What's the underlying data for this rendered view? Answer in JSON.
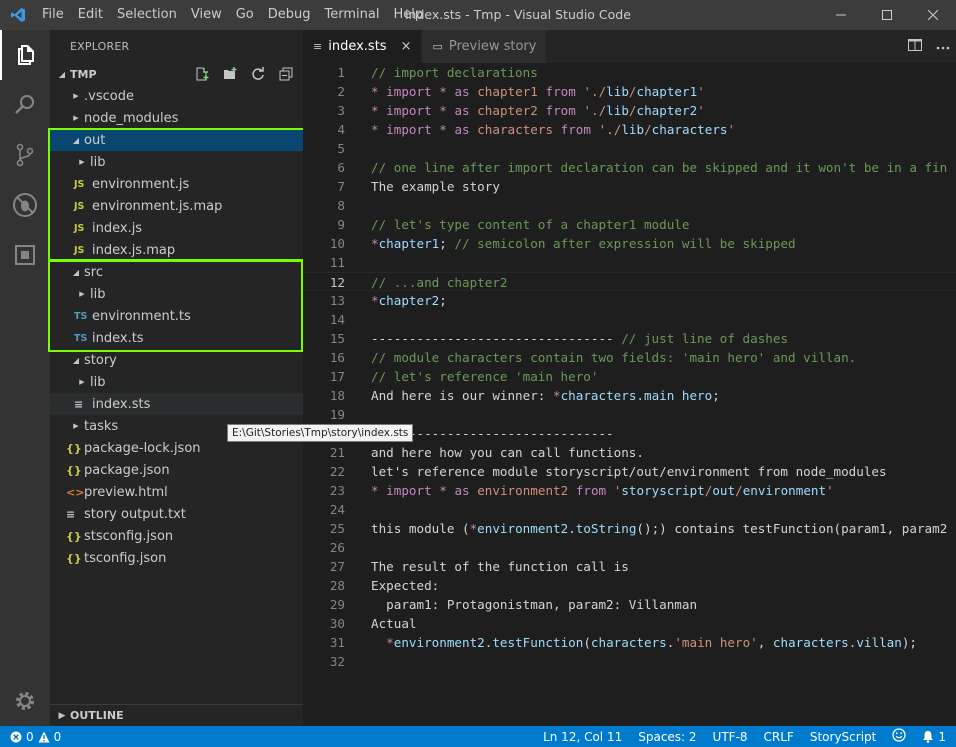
{
  "window": {
    "title": "index.sts - Tmp - Visual Studio Code",
    "menu": [
      "File",
      "Edit",
      "Selection",
      "View",
      "Go",
      "Debug",
      "Terminal",
      "Help"
    ]
  },
  "sidebar": {
    "title": "EXPLORER",
    "root": "TMP",
    "outline": "OUTLINE",
    "tree": [
      {
        "label": ".vscode",
        "indent": 1,
        "type": "folder",
        "open": false
      },
      {
        "label": "node_modules",
        "indent": 1,
        "type": "folder",
        "open": false
      },
      {
        "label": "out",
        "indent": 1,
        "type": "folder",
        "open": true,
        "selected": true
      },
      {
        "label": "lib",
        "indent": 2,
        "type": "folder",
        "open": false
      },
      {
        "label": "environment.js",
        "indent": 2,
        "type": "js"
      },
      {
        "label": "environment.js.map",
        "indent": 2,
        "type": "js"
      },
      {
        "label": "index.js",
        "indent": 2,
        "type": "js"
      },
      {
        "label": "index.js.map",
        "indent": 2,
        "type": "js"
      },
      {
        "label": "src",
        "indent": 1,
        "type": "folder",
        "open": true
      },
      {
        "label": "lib",
        "indent": 2,
        "type": "folder",
        "open": false
      },
      {
        "label": "environment.ts",
        "indent": 2,
        "type": "ts"
      },
      {
        "label": "index.ts",
        "indent": 2,
        "type": "ts"
      },
      {
        "label": "story",
        "indent": 1,
        "type": "folder",
        "open": true
      },
      {
        "label": "lib",
        "indent": 2,
        "type": "folder",
        "open": false
      },
      {
        "label": "index.sts",
        "indent": 2,
        "type": "lines",
        "hover": true
      },
      {
        "label": "tasks",
        "indent": 1,
        "type": "folder",
        "open": false
      },
      {
        "label": "package-lock.json",
        "indent": 1,
        "type": "json"
      },
      {
        "label": "package.json",
        "indent": 1,
        "type": "json"
      },
      {
        "label": "preview.html",
        "indent": 1,
        "type": "html"
      },
      {
        "label": "story output.txt",
        "indent": 1,
        "type": "lines"
      },
      {
        "label": "stsconfig.json",
        "indent": 1,
        "type": "json"
      },
      {
        "label": "tsconfig.json",
        "indent": 1,
        "type": "json"
      }
    ],
    "icon_glyphs": {
      "js": "JS",
      "ts": "TS",
      "json": "{}",
      "html": "<>",
      "lines": "≡"
    }
  },
  "tooltip": "E:\\Git\\Stories\\Tmp\\story\\index.sts",
  "tabs": [
    {
      "label": "index.sts",
      "active": true,
      "close": "×"
    },
    {
      "label": "Preview story",
      "active": false
    }
  ],
  "editor": {
    "current_line": 12,
    "lines": [
      [
        [
          "cm",
          "// import declarations"
        ]
      ],
      [
        [
          "kw",
          "* "
        ],
        [
          "kw",
          "import"
        ],
        [
          "pl",
          " "
        ],
        [
          "kw",
          "*"
        ],
        [
          "pl",
          " "
        ],
        [
          "kw",
          "as"
        ],
        [
          "pl",
          " "
        ],
        [
          "st",
          "chapter1"
        ],
        [
          "pl",
          " "
        ],
        [
          "kw",
          "from"
        ],
        [
          "pl",
          " "
        ],
        [
          "st",
          "'./"
        ],
        [
          "id",
          "lib"
        ],
        [
          "st",
          "/"
        ],
        [
          "id",
          "chapter1"
        ],
        [
          "st",
          "'"
        ]
      ],
      [
        [
          "kw",
          "* "
        ],
        [
          "kw",
          "import"
        ],
        [
          "pl",
          " "
        ],
        [
          "kw",
          "*"
        ],
        [
          "pl",
          " "
        ],
        [
          "kw",
          "as"
        ],
        [
          "pl",
          " "
        ],
        [
          "st",
          "chapter2"
        ],
        [
          "pl",
          " "
        ],
        [
          "kw",
          "from"
        ],
        [
          "pl",
          " "
        ],
        [
          "st",
          "'./"
        ],
        [
          "id",
          "lib"
        ],
        [
          "st",
          "/"
        ],
        [
          "id",
          "chapter2"
        ],
        [
          "st",
          "'"
        ]
      ],
      [
        [
          "kw",
          "* "
        ],
        [
          "kw",
          "import"
        ],
        [
          "pl",
          " "
        ],
        [
          "kw",
          "*"
        ],
        [
          "pl",
          " "
        ],
        [
          "kw",
          "as"
        ],
        [
          "pl",
          " "
        ],
        [
          "st",
          "characters"
        ],
        [
          "pl",
          " "
        ],
        [
          "kw",
          "from"
        ],
        [
          "pl",
          " "
        ],
        [
          "st",
          "'./"
        ],
        [
          "id",
          "lib"
        ],
        [
          "st",
          "/"
        ],
        [
          "id",
          "characters"
        ],
        [
          "st",
          "'"
        ]
      ],
      [],
      [
        [
          "cm",
          "// one line after import declaration can be skipped and it won't be in a fin"
        ]
      ],
      [
        [
          "pl",
          "The example story"
        ]
      ],
      [],
      [
        [
          "cm",
          "// let's type content of a chapter1 module"
        ]
      ],
      [
        [
          "kw",
          "*"
        ],
        [
          "id",
          "chapter1"
        ],
        [
          "pl",
          "; "
        ],
        [
          "cm",
          "// semicolon after expression will be skipped"
        ]
      ],
      [],
      [
        [
          "cm",
          "// ...and chapter2"
        ]
      ],
      [
        [
          "kw",
          "*"
        ],
        [
          "id",
          "chapter2"
        ],
        [
          "pl",
          ";"
        ]
      ],
      [],
      [
        [
          "pl",
          "-------------------------------- "
        ],
        [
          "cm",
          "// just line of dashes"
        ]
      ],
      [
        [
          "cm",
          "// module characters contain two fields: 'main hero' and villan."
        ]
      ],
      [
        [
          "cm",
          "// let's reference 'main hero'"
        ]
      ],
      [
        [
          "pl",
          "And here is our winner: "
        ],
        [
          "kw",
          "*"
        ],
        [
          "id",
          "characters.main hero"
        ],
        [
          "pl",
          ";"
        ]
      ],
      [],
      [
        [
          "pl",
          "--------------------------------"
        ]
      ],
      [
        [
          "pl",
          "and here how you can call functions."
        ]
      ],
      [
        [
          "pl",
          "let's reference module storyscript/out/environment from node_modules"
        ]
      ],
      [
        [
          "kw",
          "* "
        ],
        [
          "kw",
          "import"
        ],
        [
          "pl",
          " "
        ],
        [
          "kw",
          "*"
        ],
        [
          "pl",
          " "
        ],
        [
          "kw",
          "as"
        ],
        [
          "pl",
          " "
        ],
        [
          "st",
          "environment2"
        ],
        [
          "pl",
          " "
        ],
        [
          "kw",
          "from"
        ],
        [
          "pl",
          " "
        ],
        [
          "st",
          "'"
        ],
        [
          "id",
          "storyscript"
        ],
        [
          "st",
          "/"
        ],
        [
          "id",
          "out"
        ],
        [
          "st",
          "/"
        ],
        [
          "id",
          "environment"
        ],
        [
          "st",
          "'"
        ]
      ],
      [],
      [
        [
          "pl",
          "this module ("
        ],
        [
          "kw",
          "*"
        ],
        [
          "id",
          "environment2.toString"
        ],
        [
          "pl",
          "();) contains testFunction(param1, param2"
        ]
      ],
      [],
      [
        [
          "pl",
          "The result of the function call is"
        ]
      ],
      [
        [
          "pl",
          "Expected:"
        ]
      ],
      [
        [
          "pl",
          "  param1: Protagonistman, param2: Villanman"
        ]
      ],
      [
        [
          "pl",
          "Actual"
        ]
      ],
      [
        [
          "pl",
          "  "
        ],
        [
          "kw",
          "*"
        ],
        [
          "id",
          "environment2.testFunction"
        ],
        [
          "pl",
          "("
        ],
        [
          "id",
          "characters"
        ],
        [
          "pl",
          "."
        ],
        [
          "st",
          "'main hero'"
        ],
        [
          "pl",
          ", "
        ],
        [
          "id",
          "characters.villan"
        ],
        [
          "pl",
          ");"
        ]
      ],
      []
    ]
  },
  "statusbar": {
    "errors": "0",
    "warnings": "0",
    "position": "Ln 12, Col 11",
    "spaces": "Spaces: 2",
    "encoding": "UTF-8",
    "eol": "CRLF",
    "language": "StoryScript",
    "notifications": "1"
  },
  "colors": {
    "accent": "#007acc",
    "highlight_box": "#7cfc00",
    "selection": "#094771"
  }
}
